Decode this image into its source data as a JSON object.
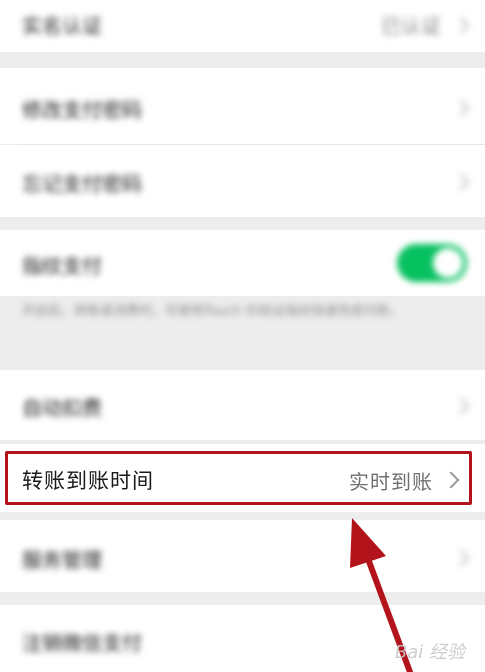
{
  "settings": {
    "row1": {
      "label": "实名认证",
      "value": "已认证"
    },
    "row2": {
      "label": "修改支付密码"
    },
    "row3": {
      "label": "忘记支付密码"
    },
    "row4": {
      "label": "指纹支付",
      "enabled": true
    },
    "row4_desc": "开启后，转账或消费时，可使用Touch ID验证指纹快速完成付款。",
    "row5": {
      "label": "自动扣费"
    },
    "row6": {
      "label": "转账到账时间",
      "value": "实时到账"
    },
    "row7": {
      "label": "服务管理"
    },
    "row8": {
      "label": "注销微信支付"
    }
  },
  "annotation": {
    "highlight_color": "#b3131a",
    "arrow_color": "#b3131a",
    "watermark": "Bai 经验"
  },
  "colors": {
    "toggle_on": "#07c160",
    "background": "#ededed"
  }
}
